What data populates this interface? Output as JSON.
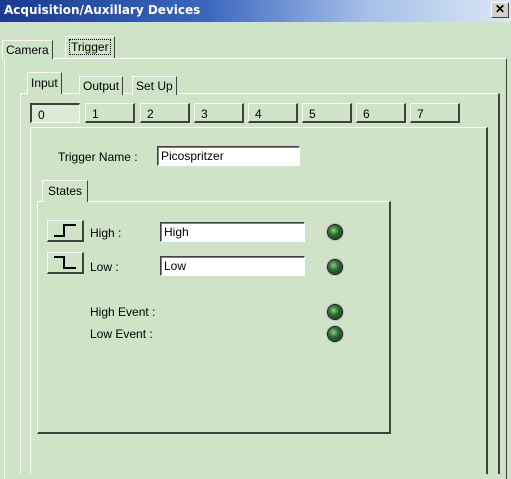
{
  "window": {
    "title": "Acquisition/Auxillary Devices",
    "close_glyph": "✕"
  },
  "top_tabs": [
    {
      "label": "Camera"
    },
    {
      "label": "Trigger"
    }
  ],
  "sub_tabs": [
    {
      "label": "Input"
    },
    {
      "label": "Output"
    },
    {
      "label": "Set Up"
    }
  ],
  "trigger_numbers": [
    "0",
    "1",
    "2",
    "3",
    "4",
    "5",
    "6",
    "7"
  ],
  "selected_trigger": "0",
  "trigger_name": {
    "label": "Trigger Name :",
    "value": "Picospritzer"
  },
  "states_tab": {
    "label": "States"
  },
  "high": {
    "label": "High :",
    "value": "High",
    "icon": "rising-edge-icon"
  },
  "low": {
    "label": "Low :",
    "value": "Low",
    "icon": "falling-edge-icon"
  },
  "events": {
    "high_event_label": "High Event :",
    "low_event_label": "Low Event :"
  },
  "colors": {
    "background": "#cfe3c7",
    "title_dark": "#1a3a8e",
    "led": "#2f6b2f"
  }
}
